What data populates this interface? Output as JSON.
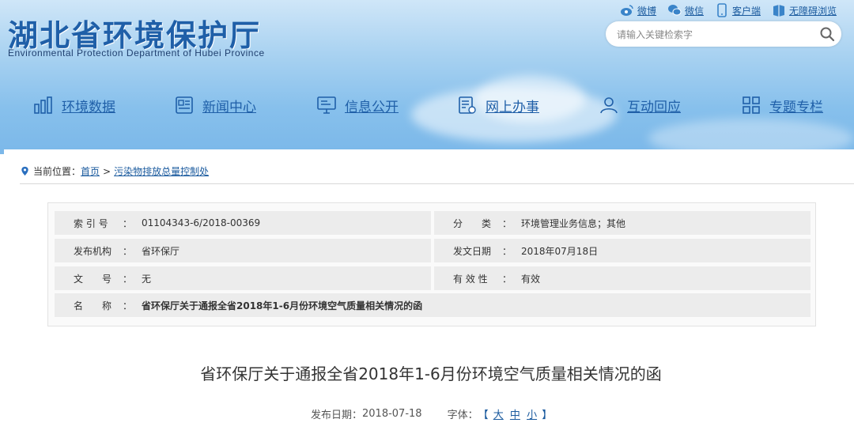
{
  "site": {
    "title_cn": "湖北省环境保护厅",
    "title_en": "Environmental Protection Department of Hubei Province"
  },
  "top_links": [
    {
      "label": "微博",
      "icon": "weibo-icon"
    },
    {
      "label": "微信",
      "icon": "wechat-icon"
    },
    {
      "label": "客户端",
      "icon": "mobile-client-icon"
    },
    {
      "label": "无障碍浏览",
      "icon": "accessibility-icon"
    }
  ],
  "search": {
    "placeholder": "请输入关键检索字"
  },
  "nav": [
    {
      "label": "环境数据",
      "icon": "bar-chart-icon"
    },
    {
      "label": "新闻中心",
      "icon": "news-icon"
    },
    {
      "label": "信息公开",
      "icon": "monitor-icon"
    },
    {
      "label": "网上办事",
      "icon": "form-icon"
    },
    {
      "label": "互动回应",
      "icon": "user-icon"
    },
    {
      "label": "专题专栏",
      "icon": "grid-icon"
    }
  ],
  "breadcrumb": {
    "prefix": "当前位置：",
    "home": "首页",
    "separator": ">",
    "current": "污染物排放总量控制处"
  },
  "meta": {
    "index_label": "索 引 号",
    "index_value": "01104343-6/2018-00369",
    "category_label": "分　　类",
    "category_value": "环境管理业务信息；其他",
    "publisher_label": "发布机构",
    "publisher_value": "省环保厅",
    "issue_date_label": "发文日期",
    "issue_date_value": "2018年07月18日",
    "doc_no_label": "文　　号",
    "doc_no_value": "无",
    "validity_label": "有 效 性",
    "validity_value": "有效",
    "name_label": "名　　称",
    "name_value": "省环保厅关于通报全省2018年1-6月份环境空气质量相关情况的函",
    "colon": "："
  },
  "article": {
    "title": "省环保厅关于通报全省2018年1-6月份环境空气质量相关情况的函",
    "publish_date_label": "发布日期：",
    "publish_date": "2018-07-18",
    "font_label": "字体：",
    "font_open": "【",
    "font_large": "大",
    "font_medium": "中",
    "font_small": "小",
    "font_close": "】"
  },
  "colors": {
    "brand_blue": "#1f5fa8",
    "link_blue": "#1a5a9e"
  }
}
